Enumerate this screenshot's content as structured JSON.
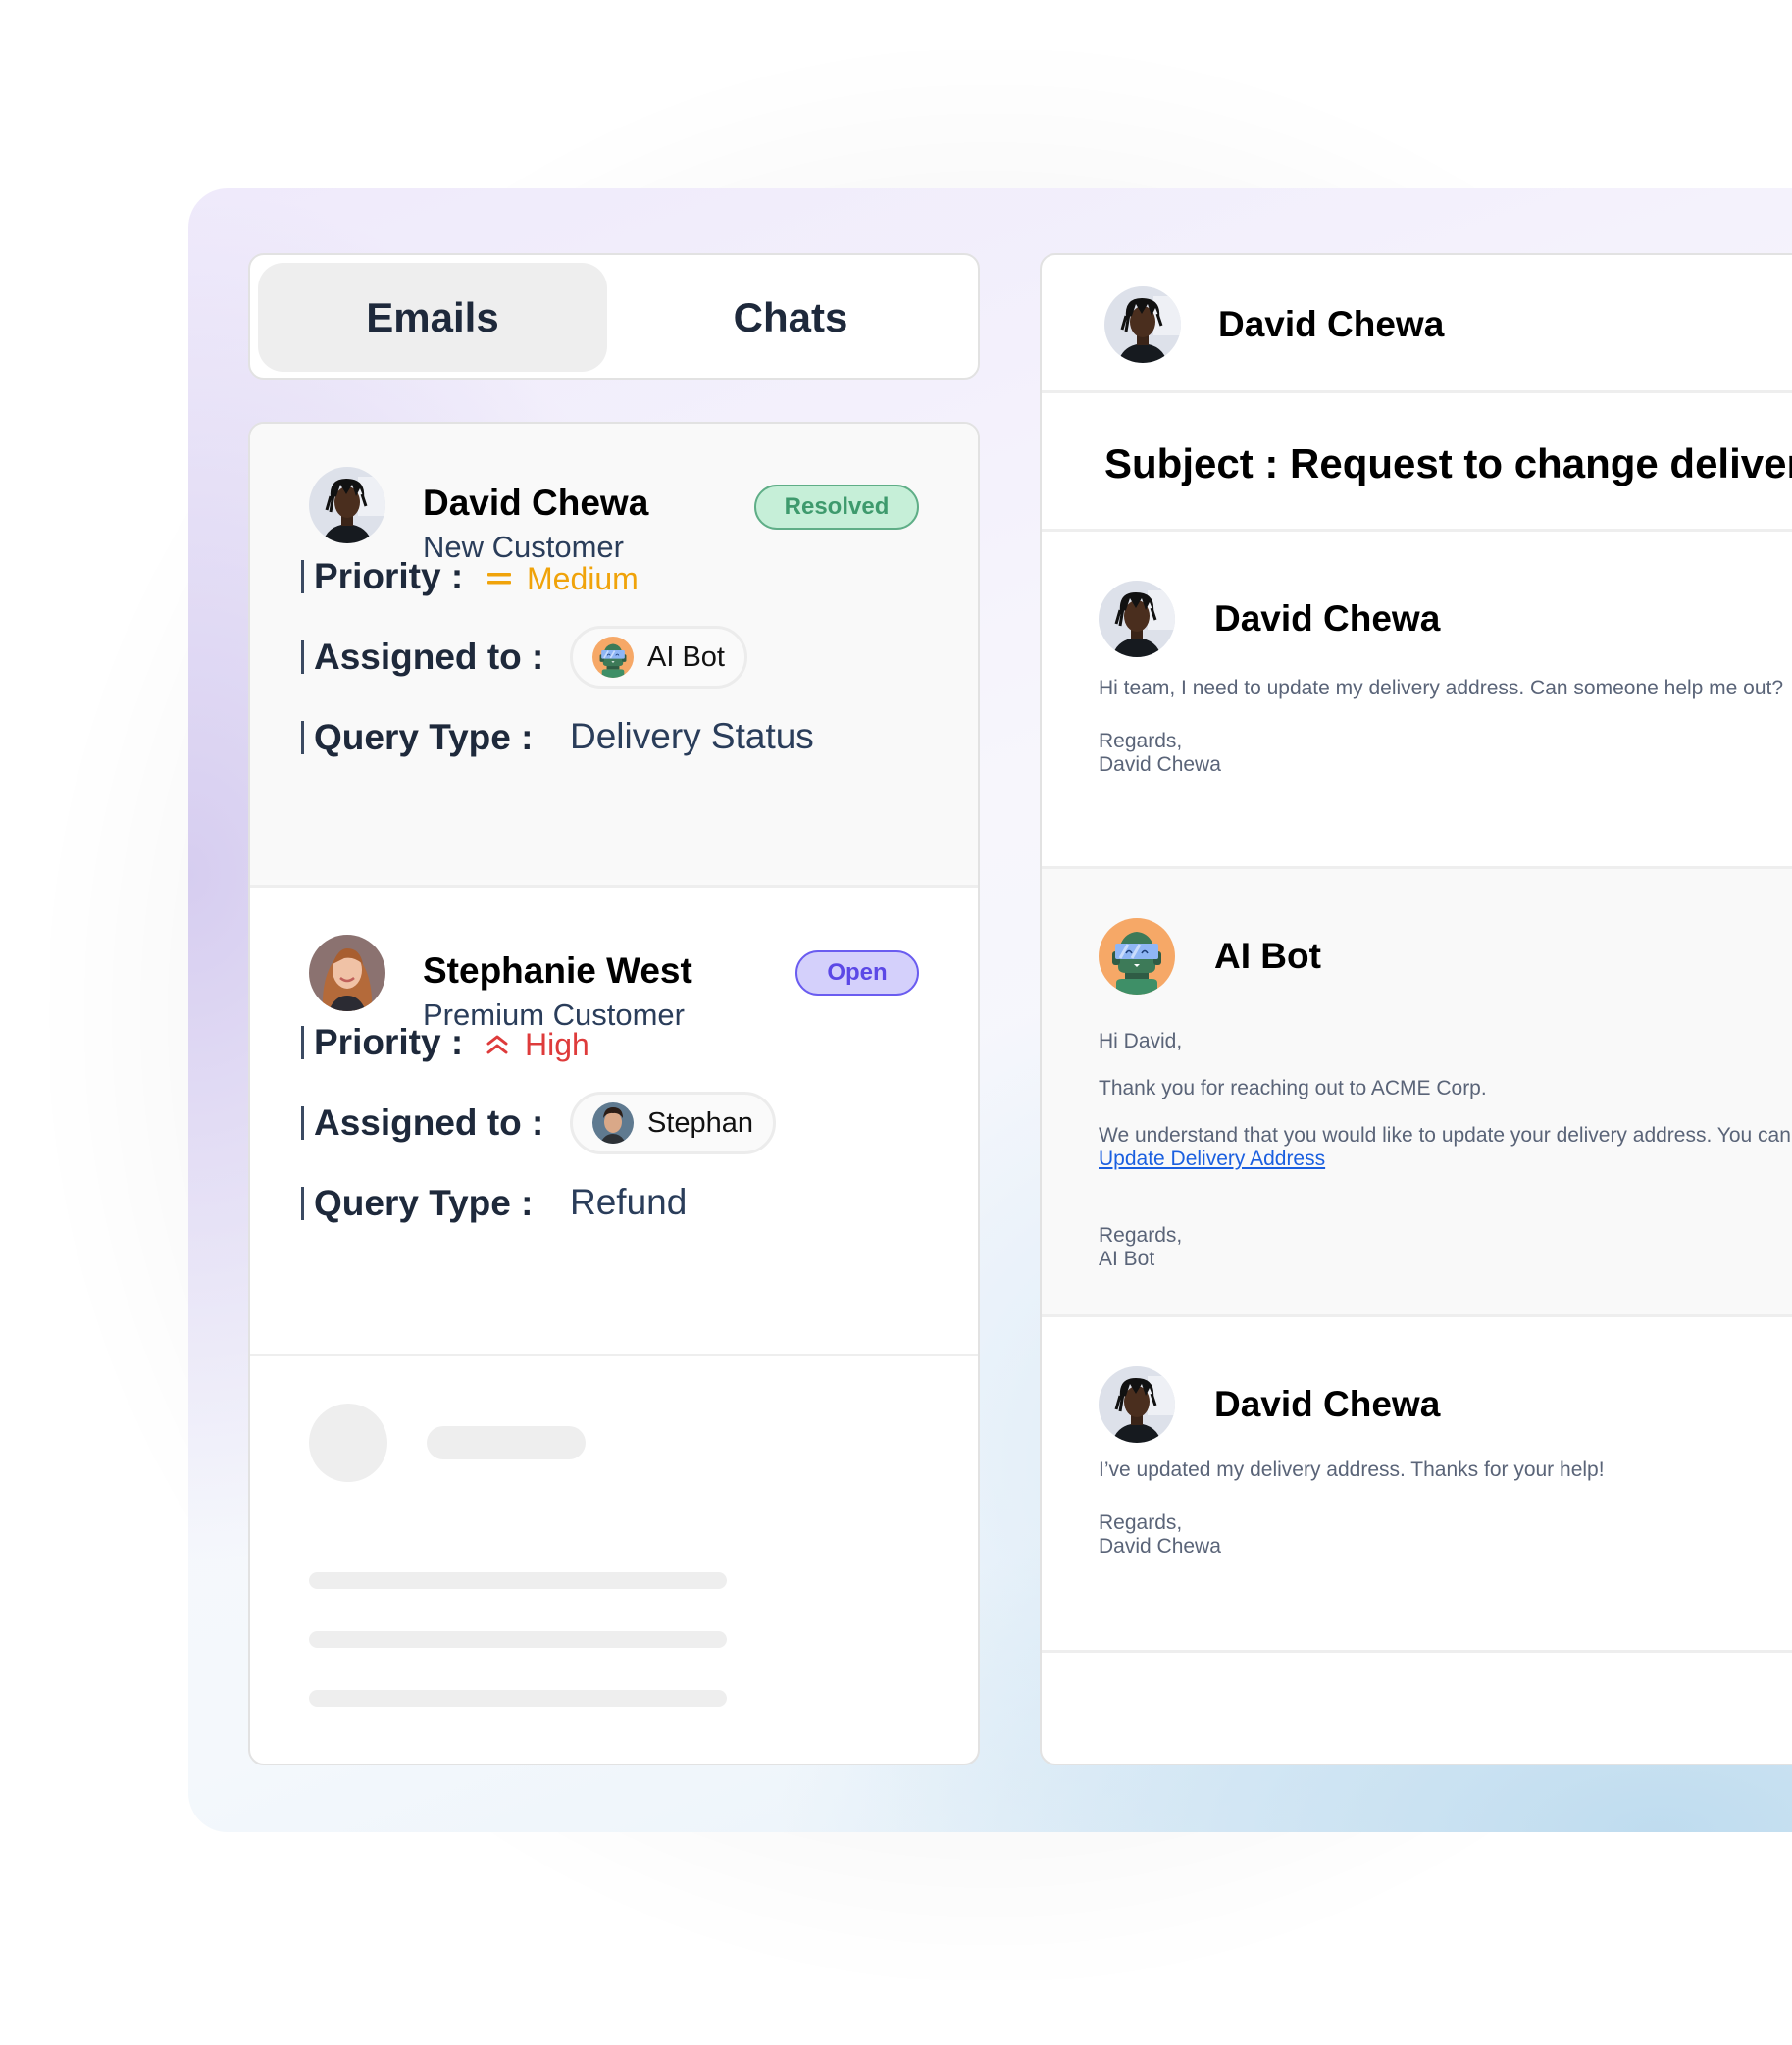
{
  "tabs": [
    {
      "label": "Emails",
      "active": true
    },
    {
      "label": "Chats",
      "active": false
    }
  ],
  "tickets": [
    {
      "name": "David Chewa",
      "customer_type": "New Customer",
      "status": "Resolved",
      "priority_label": "Priority :",
      "priority": "Medium",
      "priority_icon": "equals-icon",
      "assigned_label": "Assigned to :",
      "assignee": "AI Bot",
      "query_label": "Query Type :",
      "query_type": "Delivery Status"
    },
    {
      "name": "Stephanie West",
      "customer_type": "Premium Customer",
      "status": "Open",
      "priority_label": "Priority :",
      "priority": "High",
      "priority_icon": "double-chevron-up-icon",
      "assigned_label": "Assigned to :",
      "assignee": "Stephan",
      "query_label": "Query Type :",
      "query_type": "Refund"
    }
  ],
  "colors": {
    "priority_medium": "#f0a30a",
    "priority_high": "#de3b3b",
    "status_resolved": "#3e9a6d",
    "status_open": "#5b48e6",
    "link": "#1a5fe0"
  },
  "detail": {
    "contact_name": "David Chewa",
    "subject": "Subject : Request to change delivery address",
    "messages": [
      {
        "sender": "David Chewa",
        "lines": [
          "Hi team, I need to update my delivery address. Can someone help me out?"
        ],
        "regards": "Regards,",
        "signature": "David Chewa"
      },
      {
        "sender": "AI Bot",
        "greeting": "Hi David,",
        "line1": "Thank you for reaching out to ACME Corp.",
        "line2": "We understand that you would like to update your delivery address. You can do so using the link below:",
        "link_text": "Update Delivery Address",
        "regards": "Regards,",
        "signature": "AI Bot"
      },
      {
        "sender": "David Chewa",
        "lines": [
          "I’ve updated my delivery address. Thanks for your help!"
        ],
        "regards": "Regards,",
        "signature": "David Chewa"
      }
    ]
  }
}
